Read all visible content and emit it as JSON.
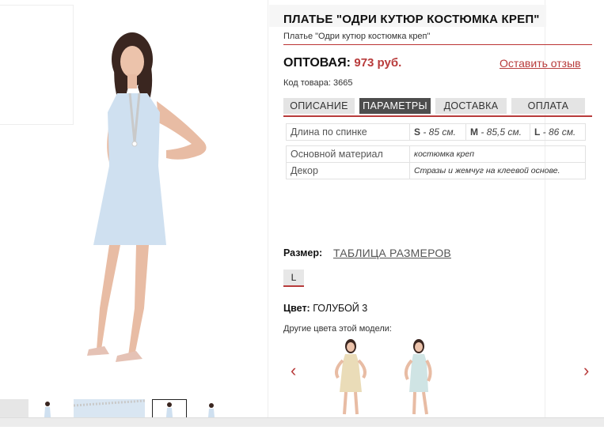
{
  "product": {
    "title": "ПЛАТЬЕ \"ОДРИ КУТЮР КОСТЮМКА КРЕП\"",
    "subtitle": "Платье \"Одри кутюр костюмка креп\"",
    "price_label": "ОПТОВАЯ:",
    "price_value": "973 руб.",
    "review_link": "Оставить отзыв",
    "sku": "Код товара: 3665"
  },
  "tabs": [
    {
      "label": "ОПИСАНИЕ",
      "active": false
    },
    {
      "label": "ПАРАМЕТРЫ",
      "active": true
    },
    {
      "label": "ДОСТАВКА",
      "active": false
    },
    {
      "label": "ОПЛАТА",
      "active": false
    }
  ],
  "params": {
    "length_label": "Длина по спинке",
    "sizes": [
      {
        "key": "S",
        "val": " - 85 см."
      },
      {
        "key": "M",
        "val": " - 85,5 см."
      },
      {
        "key": "L",
        "val": " - 86 см."
      }
    ],
    "material_label": "Основной материал",
    "material_value": "костюмка креп",
    "decor_label": "Декор",
    "decor_value": "Стразы и жемчуг на клеевой основе."
  },
  "size": {
    "label": "Размер:",
    "table_link": "ТАБЛИЦА РАЗМЕРОВ",
    "option": "L"
  },
  "color": {
    "label": "Цвет:",
    "value": "ГОЛУБОЙ 3",
    "other_label": "Другие цвета этой модели:"
  },
  "colors": {
    "accent": "#b83b3b",
    "dress_blue": "#cfe0f0",
    "dress_beige": "#eadcb8",
    "dress_mint": "#cfe4e4"
  },
  "icons": {
    "prev": "‹",
    "next": "›"
  }
}
